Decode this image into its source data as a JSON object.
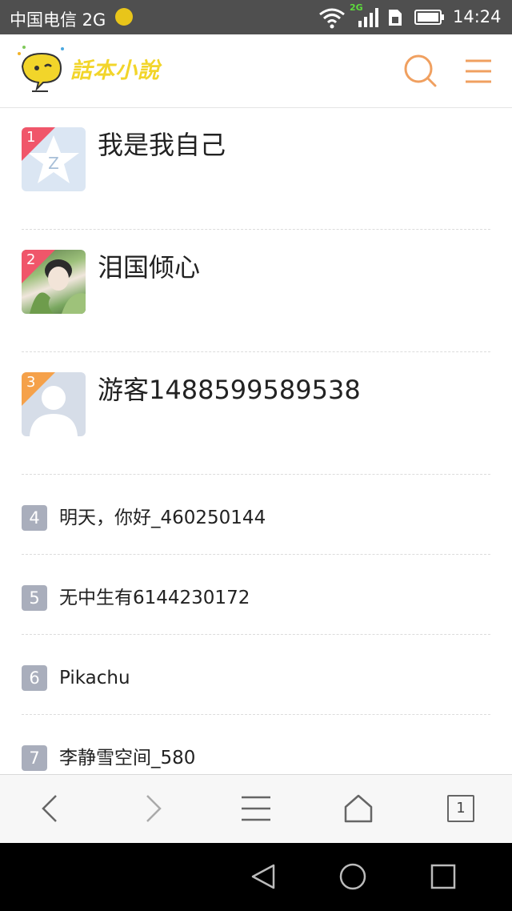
{
  "status_bar": {
    "carrier": "中国电信 2G",
    "network_badge": "2G",
    "time": "14:24"
  },
  "header": {
    "logo_text": "話本小說",
    "search_icon": "search-icon",
    "menu_icon": "menu-icon"
  },
  "ranking": {
    "top": [
      {
        "rank": "1",
        "name": "我是我自己",
        "flag_color": "#f0566a",
        "avatar": "qq-star-avatar"
      },
      {
        "rank": "2",
        "name": "泪国倾心",
        "flag_color": "#f0566a",
        "avatar": "photo-avatar"
      },
      {
        "rank": "3",
        "name": "游客1488599589538",
        "flag_color": "#f5a14a",
        "avatar": "default-person-avatar"
      }
    ],
    "rest": [
      {
        "rank": "4",
        "name": "明天，你好_460250144"
      },
      {
        "rank": "5",
        "name": "无中生有6144230172"
      },
      {
        "rank": "6",
        "name": "Pikachu"
      },
      {
        "rank": "7",
        "name": "李静雪空间_580"
      }
    ]
  },
  "toolbar": {
    "back_icon": "chevron-left-icon",
    "forward_icon": "chevron-right-icon",
    "menu_icon": "menu-icon",
    "home_icon": "home-icon",
    "tabs_count": "1"
  },
  "colors": {
    "accent_orange": "#f0a060",
    "rank_red": "#f0566a",
    "rank_orange": "#f5a14a",
    "rank_grey": "#a9aebc"
  }
}
